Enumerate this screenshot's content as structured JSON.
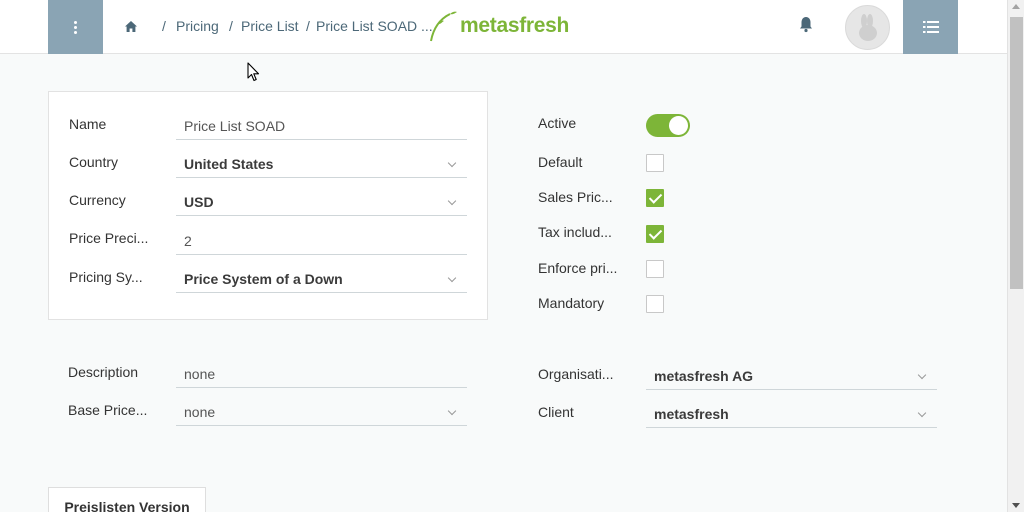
{
  "header": {
    "breadcrumbs": [
      "Pricing",
      "Price List",
      "Price List SOAD ..."
    ],
    "separators": [
      "/",
      "/",
      "/"
    ],
    "logo_text": "metasfresh"
  },
  "icons": {
    "menu": "vertical-dots-icon",
    "home": "home-icon",
    "bell": "bell-icon",
    "avatar": "rabbit-avatar-icon",
    "list": "list-icon"
  },
  "colors": {
    "accent": "#7db538",
    "header_button": "#8aa4b4",
    "breadcrumb": "#4c6878"
  },
  "form": {
    "name": {
      "label": "Name",
      "value": "Price List SOAD"
    },
    "country": {
      "label": "Country",
      "value": "United States"
    },
    "currency": {
      "label": "Currency",
      "value": "USD"
    },
    "price_precision": {
      "label": "Price Preci...",
      "value": "2"
    },
    "pricing_system": {
      "label": "Pricing Sy...",
      "value": "Price System of a Down"
    },
    "active": {
      "label": "Active",
      "value": true
    },
    "default": {
      "label": "Default",
      "value": false
    },
    "sales_price_list": {
      "label": "Sales Pric...",
      "value": true
    },
    "tax_included": {
      "label": "Tax includ...",
      "value": true
    },
    "enforce_price_limit": {
      "label": "Enforce pri...",
      "value": false
    },
    "mandatory": {
      "label": "Mandatory",
      "value": false
    },
    "description": {
      "label": "Description",
      "value": "none"
    },
    "base_price_list": {
      "label": "Base Price...",
      "value": "none"
    },
    "organisation": {
      "label": "Organisati...",
      "value": "metasfresh AG"
    },
    "client": {
      "label": "Client",
      "value": "metasfresh"
    }
  },
  "tabs": [
    {
      "label": "Preislisten Version"
    }
  ]
}
